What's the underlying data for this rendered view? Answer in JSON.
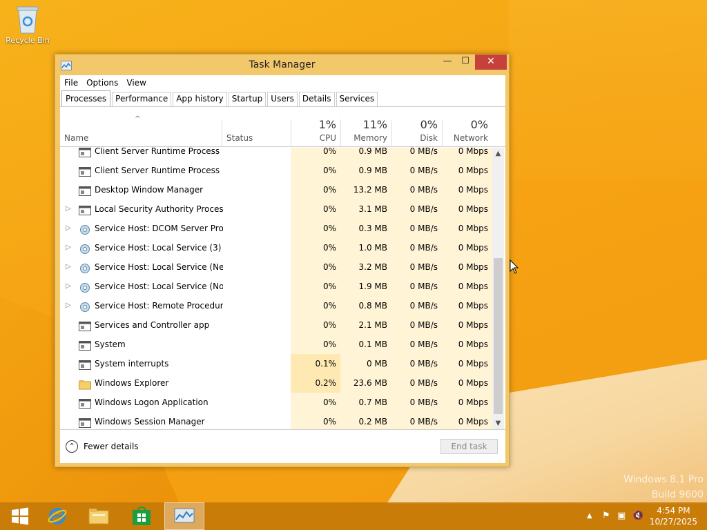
{
  "desktop": {
    "recycle_bin_label": "Recycle Bin",
    "watermark_line1": "Windows 8.1 Pro",
    "watermark_line2": "Build 9600"
  },
  "window": {
    "title": "Task Manager",
    "minimize_glyph": "—",
    "maximize_glyph": "☐",
    "close_glyph": "✕",
    "menu": [
      "File",
      "Options",
      "View"
    ],
    "tabs": [
      "Processes",
      "Performance",
      "App history",
      "Startup",
      "Users",
      "Details",
      "Services"
    ],
    "active_tab": "Processes"
  },
  "columns": {
    "name": "Name",
    "status": "Status",
    "cpu": {
      "label": "CPU",
      "total": "1%"
    },
    "memory": {
      "label": "Memory",
      "total": "11%"
    },
    "disk": {
      "label": "Disk",
      "total": "0%"
    },
    "network": {
      "label": "Network",
      "total": "0%"
    },
    "sort_glyph": "^"
  },
  "processes": [
    {
      "name": "Client Server Runtime Process",
      "cpu": "0%",
      "memory": "0.9 MB",
      "disk": "0 MB/s",
      "network": "0 Mbps",
      "expandable": false,
      "icon": "app-window-icon"
    },
    {
      "name": "Client Server Runtime Process",
      "cpu": "0%",
      "memory": "0.9 MB",
      "disk": "0 MB/s",
      "network": "0 Mbps",
      "expandable": false,
      "icon": "app-window-icon"
    },
    {
      "name": "Desktop Window Manager",
      "cpu": "0%",
      "memory": "13.2 MB",
      "disk": "0 MB/s",
      "network": "0 Mbps",
      "expandable": false,
      "icon": "app-window-icon"
    },
    {
      "name": "Local Security Authority Process...",
      "cpu": "0%",
      "memory": "3.1 MB",
      "disk": "0 MB/s",
      "network": "0 Mbps",
      "expandable": true,
      "icon": "app-window-icon"
    },
    {
      "name": "Service Host: DCOM Server Proc...",
      "cpu": "0%",
      "memory": "0.3 MB",
      "disk": "0 MB/s",
      "network": "0 Mbps",
      "expandable": true,
      "icon": "gear-icon"
    },
    {
      "name": "Service Host: Local Service (3)",
      "cpu": "0%",
      "memory": "1.0 MB",
      "disk": "0 MB/s",
      "network": "0 Mbps",
      "expandable": true,
      "icon": "gear-icon"
    },
    {
      "name": "Service Host: Local Service (Net...",
      "cpu": "0%",
      "memory": "3.2 MB",
      "disk": "0 MB/s",
      "network": "0 Mbps",
      "expandable": true,
      "icon": "gear-icon"
    },
    {
      "name": "Service Host: Local Service (No I...",
      "cpu": "0%",
      "memory": "1.9 MB",
      "disk": "0 MB/s",
      "network": "0 Mbps",
      "expandable": true,
      "icon": "gear-icon"
    },
    {
      "name": "Service Host: Remote Procedure...",
      "cpu": "0%",
      "memory": "0.8 MB",
      "disk": "0 MB/s",
      "network": "0 Mbps",
      "expandable": true,
      "icon": "gear-icon"
    },
    {
      "name": "Services and Controller app",
      "cpu": "0%",
      "memory": "2.1 MB",
      "disk": "0 MB/s",
      "network": "0 Mbps",
      "expandable": false,
      "icon": "app-window-icon"
    },
    {
      "name": "System",
      "cpu": "0%",
      "memory": "0.1 MB",
      "disk": "0 MB/s",
      "network": "0 Mbps",
      "expandable": false,
      "icon": "app-window-icon"
    },
    {
      "name": "System interrupts",
      "cpu": "0.1%",
      "memory": "0 MB",
      "disk": "0 MB/s",
      "network": "0 Mbps",
      "expandable": false,
      "icon": "app-window-icon"
    },
    {
      "name": "Windows Explorer",
      "cpu": "0.2%",
      "memory": "23.6 MB",
      "disk": "0 MB/s",
      "network": "0 Mbps",
      "expandable": false,
      "icon": "folder-icon"
    },
    {
      "name": "Windows Logon Application",
      "cpu": "0%",
      "memory": "0.7 MB",
      "disk": "0 MB/s",
      "network": "0 Mbps",
      "expandable": false,
      "icon": "app-window-icon"
    },
    {
      "name": "Windows Session Manager",
      "cpu": "0%",
      "memory": "0.2 MB",
      "disk": "0 MB/s",
      "network": "0 Mbps",
      "expandable": false,
      "icon": "app-window-icon"
    }
  ],
  "footer": {
    "fewer_details": "Fewer details",
    "end_task": "End task"
  },
  "taskbar": {
    "time": "4:54 PM",
    "date": "10/27/2025",
    "items": [
      "start-icon",
      "internet-explorer-icon",
      "file-explorer-icon",
      "store-icon",
      "task-manager-icon"
    ]
  },
  "colors": {
    "accent": "#f6a313",
    "close": "#c7413b",
    "heat": "#fff4d6"
  }
}
